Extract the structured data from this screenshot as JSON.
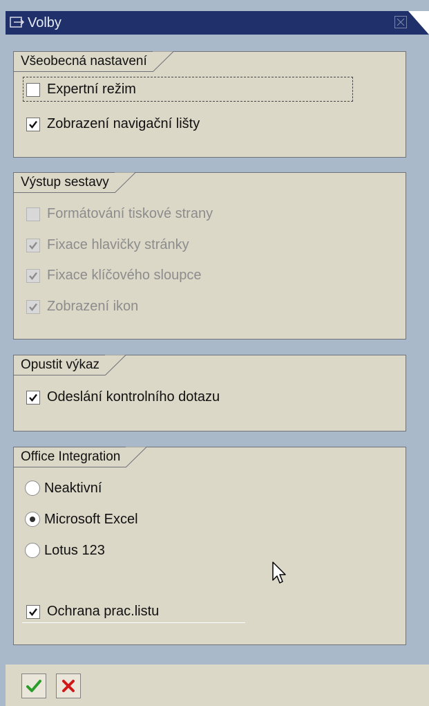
{
  "window": {
    "title": "Volby"
  },
  "groups": [
    {
      "title": "Všeobecná nastavení",
      "items": [
        {
          "label": "Expertní režim",
          "checked": false
        },
        {
          "label": "Zobrazení navigační lišty",
          "checked": true
        }
      ]
    },
    {
      "title": "Výstup sestavy",
      "items": [
        {
          "label": "Formátování tiskové strany",
          "checked": false,
          "disabled": true
        },
        {
          "label": "Fixace hlavičky stránky",
          "checked": true,
          "disabled": true
        },
        {
          "label": "Fixace klíčového sloupce",
          "checked": true,
          "disabled": true
        },
        {
          "label": "Zobrazení ikon",
          "checked": true,
          "disabled": true
        }
      ]
    },
    {
      "title": "Opustit výkaz",
      "items": [
        {
          "label": "Odeslání kontrolního dotazu",
          "checked": true
        }
      ]
    },
    {
      "title": "Office Integration",
      "radios": [
        {
          "label": "Neaktivní",
          "selected": false
        },
        {
          "label": "Microsoft Excel",
          "selected": true
        },
        {
          "label": "Lotus 123",
          "selected": false
        }
      ],
      "items": [
        {
          "label": "Ochrana prac.listu",
          "checked": true
        }
      ]
    }
  ],
  "colors": {
    "title_bar": "#20306a",
    "panel": "#dcd8c8",
    "frame": "#a9b9c9",
    "confirm": "#2a9d2a",
    "cancel": "#d01818"
  }
}
